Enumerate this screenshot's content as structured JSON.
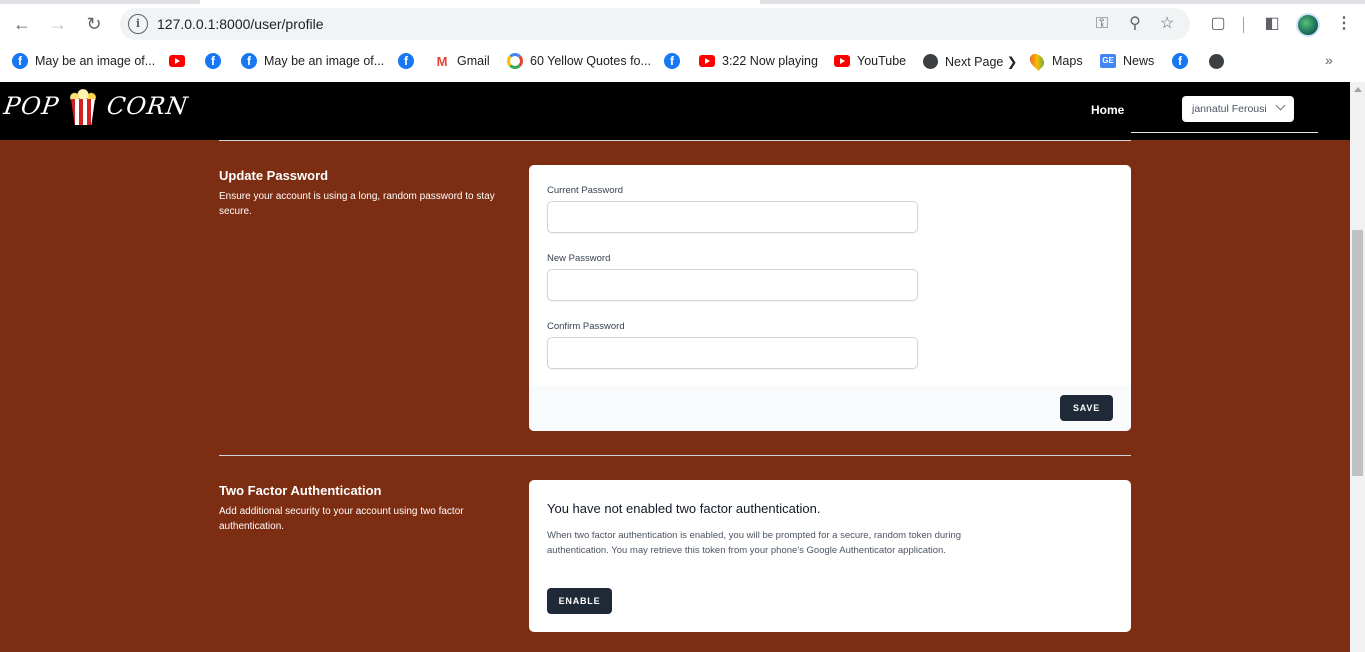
{
  "browser": {
    "url": "127.0.0.1:8000/user/profile",
    "bookmarks": [
      {
        "label": "May be an image of...",
        "icon": "facebook-icon"
      },
      {
        "label": "",
        "icon": "youtube-icon"
      },
      {
        "label": "",
        "icon": "facebook-icon"
      },
      {
        "label": "May be an image of...",
        "icon": "facebook-icon"
      },
      {
        "label": "",
        "icon": "facebook-icon"
      },
      {
        "label": "Gmail",
        "icon": "gmail-icon"
      },
      {
        "label": "60 Yellow Quotes fo...",
        "icon": "google-icon"
      },
      {
        "label": "",
        "icon": "facebook-icon"
      },
      {
        "label": "3:22 Now playing",
        "icon": "youtube-icon"
      },
      {
        "label": "YouTube",
        "icon": "youtube-icon"
      },
      {
        "label": "Next Page ❯",
        "icon": "globe-icon"
      },
      {
        "label": "Maps",
        "icon": "maps-icon"
      },
      {
        "label": "News",
        "icon": "news-icon"
      },
      {
        "label": "",
        "icon": "facebook-icon"
      },
      {
        "label": "",
        "icon": "globe-icon"
      }
    ]
  },
  "appbar": {
    "logo_left": "POP",
    "logo_right": "CORN",
    "home_label": "Home",
    "user_name": "jannatul Ferousi"
  },
  "update_password": {
    "title": "Update Password",
    "description": "Ensure your account is using a long, random password to stay secure.",
    "current_label": "Current Password",
    "new_label": "New Password",
    "confirm_label": "Confirm Password",
    "current_value": "",
    "new_value": "",
    "confirm_value": "",
    "save_label": "SAVE"
  },
  "two_factor": {
    "title": "Two Factor Authentication",
    "description": "Add additional security to your account using two factor authentication.",
    "status_heading": "You have not enabled two factor authentication.",
    "explanation": "When two factor authentication is enabled, you will be prompted for a secure, random token during authentication. You may retrieve this token from your phone's Google Authenticator application.",
    "enable_label": "ENABLE"
  },
  "colors": {
    "page_background": "#7d2d12",
    "button_dark": "#1f2937",
    "navbar": "#000000"
  }
}
